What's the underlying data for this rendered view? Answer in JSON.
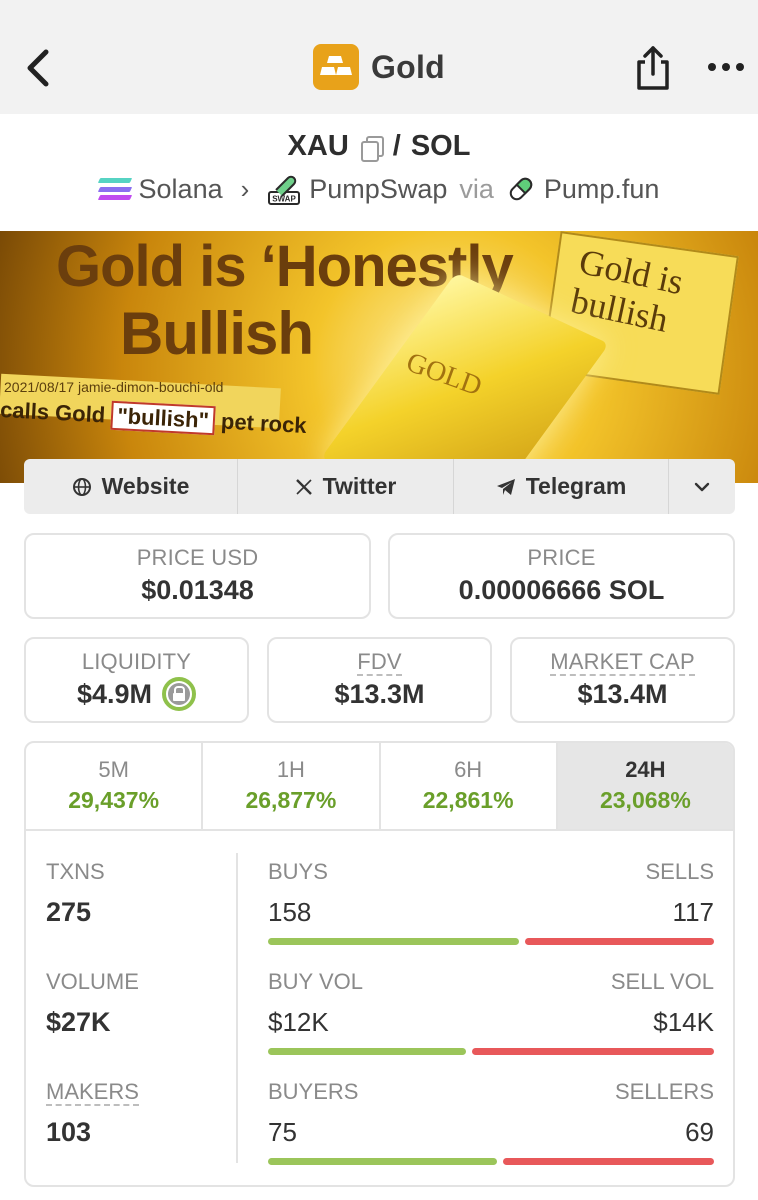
{
  "header": {
    "title": "Gold",
    "back_icon": "chevron-left-icon",
    "share_icon": "share-icon",
    "more_icon": "more-horizontal-icon"
  },
  "pair": {
    "base": "XAU",
    "separator": "/",
    "quote": "SOL"
  },
  "chain": {
    "network": "Solana",
    "dex": "PumpSwap",
    "via": "via",
    "launchpad": "Pump.fun"
  },
  "banner": {
    "headline_line1": "Gold is ‘Honestly",
    "headline_line2": "Bullish",
    "note_text": "Gold is bullish",
    "bar_text": "GOLD",
    "clip_date": "2021/08/17  jamie-dimon-bouchi-old",
    "clip_text_pre": "calls Gold ",
    "clip_text_quote": "\"bullish\"",
    "clip_text_post": " pet rock"
  },
  "links": {
    "website": "Website",
    "twitter": "Twitter",
    "telegram": "Telegram"
  },
  "prices": {
    "price_usd_label": "PRICE USD",
    "price_usd": "$0.01348",
    "price_label": "PRICE",
    "price_native": "0.00006666 SOL"
  },
  "metrics": {
    "liquidity_label": "LIQUIDITY",
    "liquidity": "$4.9M",
    "fdv_label": "FDV",
    "fdv": "$13.3M",
    "mcap_label": "MARKET CAP",
    "mcap": "$13.4M"
  },
  "timeframes": [
    {
      "label": "5M",
      "change": "29,437%"
    },
    {
      "label": "1H",
      "change": "26,877%"
    },
    {
      "label": "6H",
      "change": "22,861%"
    },
    {
      "label": "24H",
      "change": "23,068%"
    }
  ],
  "active_timeframe": "24H",
  "stats": {
    "txns_label": "TXNS",
    "txns": "275",
    "buys_label": "BUYS",
    "buys": "158",
    "sells_label": "SELLS",
    "sells": "117",
    "volume_label": "VOLUME",
    "volume": "$27K",
    "buy_vol_label": "BUY VOL",
    "buy_vol": "$12K",
    "sell_vol_label": "SELL VOL",
    "sell_vol": "$14K",
    "makers_label": "MAKERS",
    "makers": "103",
    "buyers_label": "BUYERS",
    "buyers": "75",
    "sellers_label": "SELLERS",
    "sellers": "69",
    "buys_fraction": 0.57,
    "buy_vol_fraction": 0.45,
    "buyers_fraction": 0.52
  },
  "colors": {
    "positive": "#6a9f2a",
    "bar_buy": "#9bc55a",
    "bar_sell": "#e8585a",
    "token_logo": "#e8a21a"
  }
}
